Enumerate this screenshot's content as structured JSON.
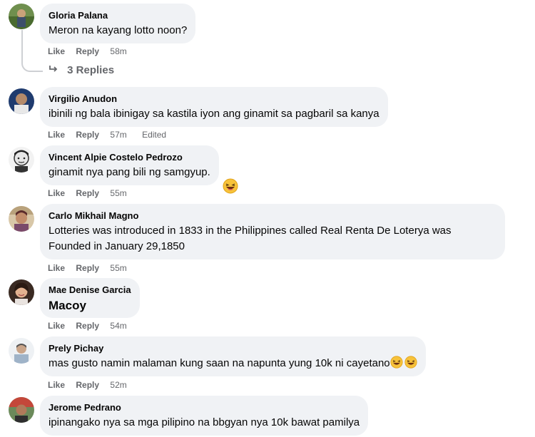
{
  "comments": [
    {
      "author": "Gloria Palana",
      "text": "Meron na kayang lotto noon?",
      "like": "Like",
      "reply": "Reply",
      "time": "58m",
      "replies_label": "3 Replies"
    },
    {
      "author": "Virgilio Anudon",
      "text": "ibinili ng bala ibinigay sa kastila iyon ang ginamit sa pagbaril sa kanya",
      "like": "Like",
      "reply": "Reply",
      "time": "57m",
      "edited": "Edited"
    },
    {
      "author": "Vincent Alpie Costelo Pedrozo",
      "text": "ginamit nya pang bili ng samgyup.",
      "like": "Like",
      "reply": "Reply",
      "time": "55m"
    },
    {
      "author": "Carlo Mikhail Magno",
      "text_line1": "Lotteries was introduced in 1833 in the Philippines called Real Renta De Loterya was",
      "text_line2": "Founded in January 29,1850",
      "like": "Like",
      "reply": "Reply",
      "time": "55m"
    },
    {
      "author": "Mae Denise Garcia",
      "text": "Macoy",
      "like": "Like",
      "reply": "Reply",
      "time": "54m"
    },
    {
      "author": "Prely Pichay",
      "text": "mas gusto namin malaman kung saan na napunta yung 10k ni cayetano",
      "like": "Like",
      "reply": "Reply",
      "time": "52m"
    },
    {
      "author": "Jerome Pedrano",
      "text": "ipinangako nya sa mga pilipino na bbgyan nya 10k bawat pamilya"
    }
  ],
  "icons": {
    "reply_arrow": "reply-arrow-icon",
    "laugh_emoji": "laughing-emoji-icon"
  },
  "colors": {
    "bubble": "#f0f2f5",
    "secondary_text": "#65676b",
    "thread_line": "#ced0d4"
  }
}
